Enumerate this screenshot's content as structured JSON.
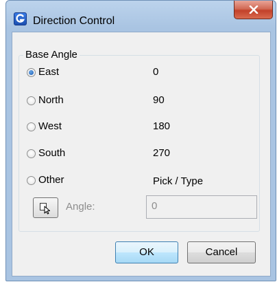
{
  "window": {
    "title": "Direction Control",
    "icon": "g-logo-icon",
    "close_icon": "close-x-icon"
  },
  "group": {
    "label": "Base Angle",
    "options": [
      {
        "label": "East",
        "value": "0",
        "checked": true
      },
      {
        "label": "North",
        "value": "90",
        "checked": false
      },
      {
        "label": "West",
        "value": "180",
        "checked": false
      },
      {
        "label": "South",
        "value": "270",
        "checked": false
      },
      {
        "label": "Other",
        "value": "Pick / Type",
        "checked": false
      }
    ]
  },
  "angle": {
    "pick_icon": "pick-cursor-icon",
    "label": "Angle:",
    "value": "0"
  },
  "buttons": {
    "ok": "OK",
    "cancel": "Cancel"
  }
}
